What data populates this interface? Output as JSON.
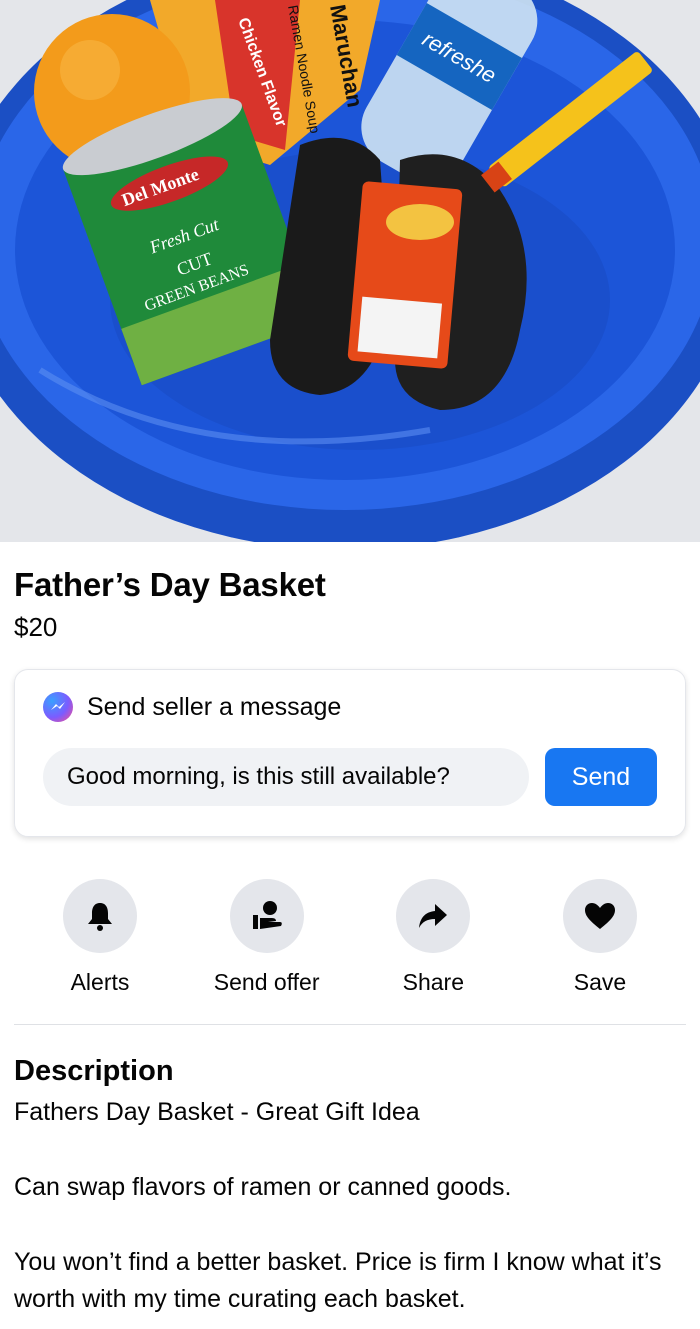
{
  "listing": {
    "title": "Father’s Day Basket",
    "price": "$20"
  },
  "photo": {
    "icon": "product-photo",
    "items": [
      "orange",
      "ramen",
      "water-bottle",
      "green-beans-can",
      "socks",
      "candy"
    ],
    "labels": {
      "ramen_brand": "Maruchan",
      "ramen_type": "Ramen Noodle Soup",
      "ramen_flavor": "Chicken Flavor",
      "water": "refreshe",
      "can_brand": "Del Monte",
      "can_line1": "Fresh Cut",
      "can_line2": "CUT",
      "can_line3": "GREEN BEANS"
    }
  },
  "message": {
    "heading": "Send seller a message",
    "input_value": "Good morning, is this still available?",
    "send_label": "Send"
  },
  "actions": [
    {
      "label": "Alerts",
      "icon": "bell-icon"
    },
    {
      "label": "Send offer",
      "icon": "offer-icon"
    },
    {
      "label": "Share",
      "icon": "share-icon"
    },
    {
      "label": "Save",
      "icon": "heart-icon"
    }
  ],
  "description": {
    "heading": "Description",
    "paragraphs": [
      "Fathers Day Basket - Great Gift Idea",
      "Can swap flavors of ramen or canned goods.",
      "You won’t find a better basket. Price is firm I know what it’s worth with my time curating each basket."
    ]
  },
  "colors": {
    "accent": "#1877f2",
    "bowl": "#1a54d6",
    "action_bg": "#e4e6eb"
  }
}
